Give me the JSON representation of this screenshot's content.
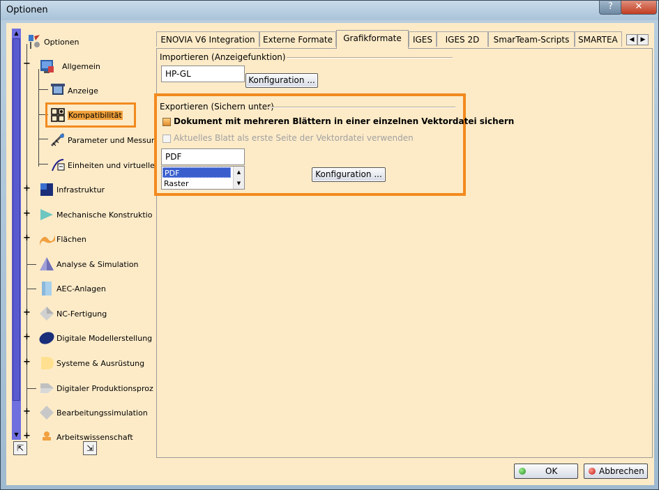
{
  "window": {
    "title": "Optionen",
    "help_label": "?",
    "close_label": "✕"
  },
  "tree": {
    "items": [
      {
        "label": "Optionen",
        "icon": "options-root-icon"
      },
      {
        "label": "Allgemein",
        "icon": "general-icon"
      },
      {
        "label": "Anzeige",
        "icon": "display-icon"
      },
      {
        "label": "Kompatibilität",
        "icon": "compatibility-icon"
      },
      {
        "label": "Parameter und Messur",
        "icon": "parameters-icon"
      },
      {
        "label": "Einheiten und virtuelle",
        "icon": "units-icon"
      },
      {
        "label": "Infrastruktur",
        "icon": "infrastructure-icon"
      },
      {
        "label": "Mechanische Konstruktio",
        "icon": "mechanical-design-icon"
      },
      {
        "label": "Flächen",
        "icon": "surfaces-icon"
      },
      {
        "label": "Analyse & Simulation",
        "icon": "analysis-icon"
      },
      {
        "label": "AEC-Anlagen",
        "icon": "aec-icon"
      },
      {
        "label": "NC-Fertigung",
        "icon": "nc-icon"
      },
      {
        "label": "Digitale Modellerstellung",
        "icon": "digital-mockup-icon"
      },
      {
        "label": "Systeme & Ausrüstung",
        "icon": "equipment-icon"
      },
      {
        "label": "Digitaler Produktionsproz",
        "icon": "production-icon"
      },
      {
        "label": "Bearbeitungssimulation",
        "icon": "machining-sim-icon"
      },
      {
        "label": "Arbeitswissenschaft",
        "icon": "ergonomics-icon"
      }
    ],
    "selected": "Kompatibilität"
  },
  "tabs": [
    {
      "label": "ENOVIA V6 Integration"
    },
    {
      "label": "Externe Formate"
    },
    {
      "label": "Grafikformate",
      "active": true
    },
    {
      "label": "IGES"
    },
    {
      "label": "IGES 2D"
    },
    {
      "label": "SmarTeam-Scripts"
    },
    {
      "label": "SMARTEA"
    }
  ],
  "import": {
    "group_label": "Importieren (Anzeigefunktion)",
    "format_value": "HP-GL",
    "config_button": "Konfiguration ..."
  },
  "export": {
    "group_label": "Exportieren (Sichern unter)",
    "checkbox1_label": "Dokument mit mehreren Blättern in einer einzelnen Vektordatei sichern",
    "checkbox1_checked": true,
    "checkbox2_label": "Aktuelles Blatt als erste Seite der Vektordatei verwenden",
    "checkbox2_checked": false,
    "format_value": "PDF",
    "options": [
      "PDF",
      "Raster"
    ],
    "selected_option": "PDF",
    "config_button": "Konfiguration ..."
  },
  "footer": {
    "ok_label": "OK",
    "cancel_label": "Abbrechen"
  },
  "colors": {
    "highlight": "#f28a1e",
    "background": "#fdebc8",
    "selection": "#3a5fcd"
  }
}
